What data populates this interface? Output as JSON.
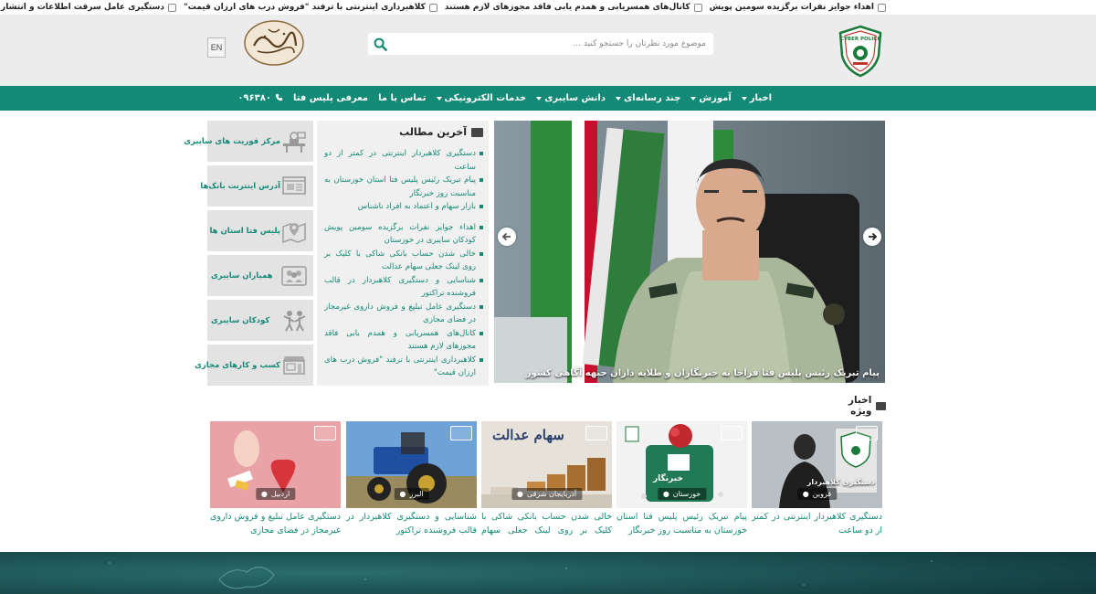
{
  "ticker": [
    "اهداء جوایز نفرات برگزیده سومین پویش",
    "کانال‌های همسریابی و همدم یابی فاقد مجوزهای لازم هستند",
    "کلاهبرداری اینترنتی با ترفند \"فروش درب های ارزان قیمت\"",
    "دستگیری عامل سرقت اطلاعات و انتشار آگهی مسروقه در سایت دیوار دستگیر شد"
  ],
  "header": {
    "logo_text": "CYBER POLICE",
    "search_placeholder": "موضوع مورد نظرتان را جستجو کنید ...",
    "lang_label": "EN"
  },
  "nav": {
    "items": [
      {
        "label": "اخبار",
        "dropdown": true
      },
      {
        "label": "آموزش",
        "dropdown": true
      },
      {
        "label": "چند رسانه‌ای",
        "dropdown": true
      },
      {
        "label": "دانش سایبری",
        "dropdown": true
      },
      {
        "label": "خدمات الکترونیکی",
        "dropdown": true
      },
      {
        "label": "تماس با ما",
        "dropdown": false
      },
      {
        "label": "معرفی پلیس فتا",
        "dropdown": false
      }
    ],
    "phone": "۰۹۶۳۸۰"
  },
  "slider": {
    "caption": "پیام تبریک رئیس پلیس فتا فراجا به خبرنگاران و طلایه داران جبهه آگاهی کشور"
  },
  "latest": {
    "title": "آخرین مطالب",
    "items": [
      "دستگیری کلاهبردار اینترنتی در کمتر از دو ساعت",
      "پیام تبریک رئیس پلیس فتا استان خوزستان به مناسبت روز خبرنگار",
      "بازار سهام و اعتماد به افراد ناشناس",
      "اهداء جوایز نفرات برگزیده سومین پویش کودکان سایبری در خوزستان",
      "خالی شدن حساب بانکی شاکی با کلیک بر روی لینک جعلی سهام عدالت",
      "شناسایی و دستگیری کلاهبردار در قالب فروشنده تراکتور",
      "دستگیری عامل تبلیغ و فروش داروی غیرمجاز در فضای مجازی",
      "کانال‌های همسریابی و همدم یابی فاقد مجوزهای لازم هستند",
      "کلاهبرداری اینترنتی با ترفند \"فروش درب های ارزان قیمت\""
    ]
  },
  "side": [
    {
      "label": "مرکز فوریت های سایبری",
      "icon": "operator-desk-icon"
    },
    {
      "label": "آدرس اینترنت بانک‌ها",
      "icon": "bank-website-icon"
    },
    {
      "label": "پلیس فتا استان ها",
      "icon": "map-pin-icon"
    },
    {
      "label": "همیاران سایبری",
      "icon": "group-people-icon"
    },
    {
      "label": "کودکان سایبری",
      "icon": "children-icon"
    },
    {
      "label": "کسب و کارهای مجازی",
      "icon": "online-shop-icon"
    }
  ],
  "featured": {
    "title": "اخبار ویژه",
    "cards": [
      {
        "title": "دستگیری کلاهبردار اینترنتی در کمتر از دو ساعت",
        "location": "قزوین",
        "overlay": "دستگیری کلاهبردار"
      },
      {
        "title": "پیام تبریک رئیس پلیس فتا استان خوزستان به مناسبت روز خبرنگار",
        "location": "خوزستان",
        "overlay": "خبرنگار"
      },
      {
        "title": "خالی شدن حساب بانکی شاکی با کلیک بر روی لینک جعلی سهام عدالت",
        "location": "آذربایجان شرقی",
        "overlay": "سهام عدالت"
      },
      {
        "title": "شناسایی و دستگیری کلاهبردار در قالب فروشنده تراکتور",
        "location": "البرز",
        "overlay": ""
      },
      {
        "title": "دستگیری عامل تبلیغ و فروش داروی غیرمجاز در فضای مجازی",
        "location": "اردبیل",
        "overlay": ""
      }
    ]
  },
  "colors": {
    "brand_green": "#138a75",
    "header_bg": "#ececec",
    "footer_bg": "#1c4a4c"
  }
}
